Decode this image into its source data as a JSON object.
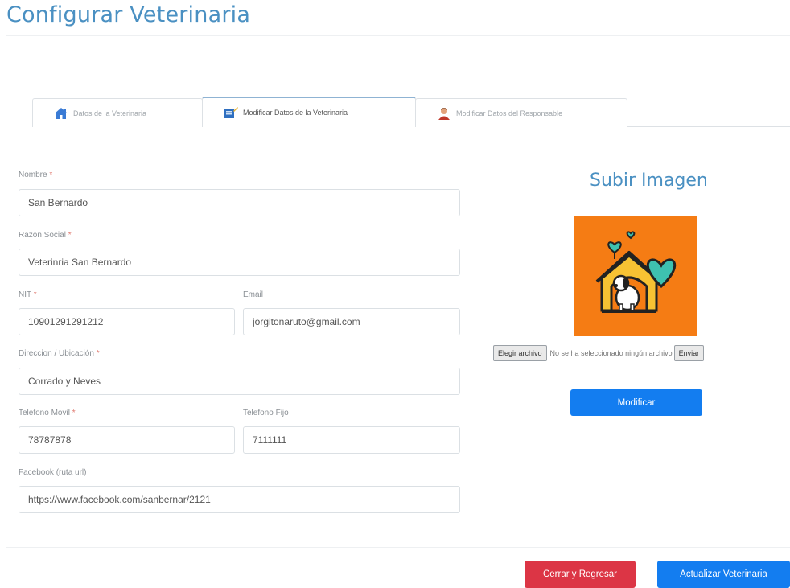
{
  "page": {
    "title": "Configurar Veterinaria"
  },
  "tabs": [
    {
      "label": "Datos de la Veterinaria",
      "icon": "house-icon"
    },
    {
      "label": "Modificar Datos de la Veterinaria",
      "icon": "edit-document-icon"
    },
    {
      "label": "Modificar Datos del Responsable",
      "icon": "person-icon"
    }
  ],
  "form": {
    "nombre": {
      "label": "Nombre",
      "required": "*",
      "value": "San Bernardo"
    },
    "razon_social": {
      "label": "Razon Social",
      "required": "*",
      "value": "Veterinria San Bernardo"
    },
    "nit": {
      "label": "NIT",
      "required": "*",
      "value": "10901291291212"
    },
    "email": {
      "label": "Email",
      "value": "jorgitonaruto@gmail.com"
    },
    "direccion": {
      "label": "Direccion / Ubicación",
      "required": "*",
      "value": "Corrado y Neves"
    },
    "telefono_movil": {
      "label": "Telefono Movil",
      "required": "*",
      "value": "78787878"
    },
    "telefono_fijo": {
      "label": "Telefono Fijo",
      "value": "7111111"
    },
    "facebook": {
      "label": "Facebook (ruta url)",
      "value": "https://www.facebook.com/sanbernar/2121"
    }
  },
  "upload": {
    "title": "Subir Imagen",
    "choose_file_label": "Elegir archivo",
    "file_status": "No se ha seleccionado ningún archivo",
    "send_label": "Enviar",
    "modify_label": "Modificar"
  },
  "footer": {
    "close_label": "Cerrar y Regresar",
    "update_label": "Actualizar Veterinaria"
  },
  "colors": {
    "accent": "#4a90c2",
    "primary": "#137df0",
    "danger": "#dc3545",
    "image_bg": "#f57c14"
  }
}
